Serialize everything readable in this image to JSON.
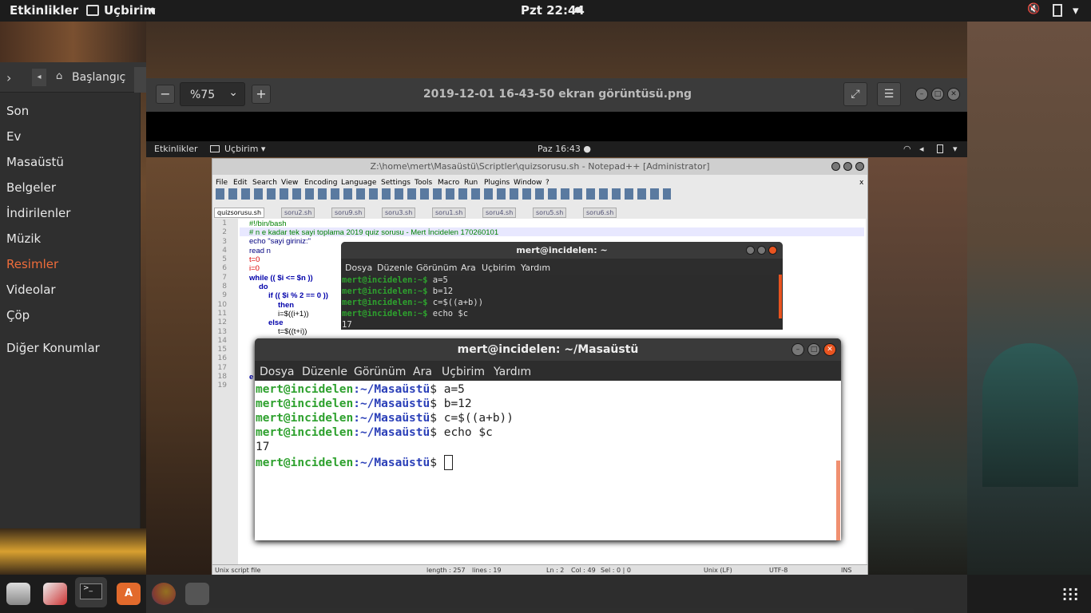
{
  "topbar": {
    "activities": "Etkinlikler",
    "app_menu": "Uçbirim",
    "app_menu_arrow": "▾",
    "clock": "Pzt 22:44",
    "clock_dot": "●",
    "sound_icon": "🔇",
    "battery_icon": "▯",
    "menu_arrow": "▾"
  },
  "files": {
    "path_home": "Başlangıç",
    "path_current": "Resimler",
    "sidebar": [
      "Son",
      "Ev",
      "Masaüstü",
      "Belgeler",
      "İndirilenler",
      "Müzik",
      "Resimler",
      "Videolar",
      "Çöp",
      "Diğer Konumlar"
    ]
  },
  "viewer": {
    "zoom": "%75",
    "title": "2019-12-01 16-43-50 ekran görüntüsü.png",
    "zoom_out": "−",
    "zoom_in": "+",
    "zoom_arrow": "⌄"
  },
  "inner": {
    "activities": "Etkinlikler",
    "app_menu": "Uçbirim ▾",
    "clock": "Paz 16:43 ●"
  },
  "npp": {
    "title": "Z:\\home\\mert\\Masaüstü\\Scriptler\\quizsorusu.sh - Notepad++ [Administrator]",
    "menu": [
      "File",
      "Edit",
      "Search",
      "View",
      "Encoding",
      "Language",
      "Settings",
      "Tools",
      "Macro",
      "Run",
      "Plugins",
      "Window",
      "?"
    ],
    "close_x": "x",
    "tabs": [
      "quizsorusu.sh",
      "soru2.sh",
      "soru9.sh",
      "soru3.sh",
      "soru1.sh",
      "soru4.sh",
      "soru5.sh",
      "soru6.sh"
    ],
    "lines": [
      "#!/bin/bash",
      "# n e kadar tek sayi toplama 2019 quiz sorusu - Mert İncidelen 170260101",
      "echo \"sayi giriniz:\"",
      "read n",
      "t=0",
      "i=0",
      "while (( $i <= $n ))",
      "do",
      "if (( $i % 2 == 0 ))",
      "then",
      "i=$((i+1))",
      "else",
      "t=$((t+i))",
      "",
      "",
      "",
      "",
      "e",
      ""
    ],
    "line_numbers": [
      "1",
      "2",
      "3",
      "4",
      "5",
      "6",
      "7",
      "8",
      "9",
      "10",
      "11",
      "12",
      "13",
      "14",
      "15",
      "16",
      "17",
      "18",
      "19"
    ],
    "status": {
      "type": "Unix script file",
      "length": "length : 257",
      "lines": "lines : 19",
      "ln": "Ln : 2",
      "col": "Col : 49",
      "sel": "Sel : 0 | 0",
      "eol": "Unix (LF)",
      "enc": "UTF-8",
      "ins": "INS"
    }
  },
  "term_small": {
    "title": "mert@incidelen: ~",
    "menu": [
      "Dosya",
      "Düzenle",
      "Görünüm",
      "Ara",
      "Uçbirim",
      "Yardım"
    ],
    "prompt": "mert@incidelen:~$",
    "commands": [
      "a=5",
      "b=12",
      "c=$((a+b))",
      "echo $c"
    ],
    "output": "17"
  },
  "term_big": {
    "title": "mert@incidelen: ~/Masaüstü",
    "menu": [
      "Dosya",
      "Düzenle",
      "Görünüm",
      "Ara",
      "Uçbirim",
      "Yardım"
    ],
    "prompt_user": "mert@incidelen",
    "prompt_path": ":~/Masaüstü",
    "prompt_end": "$",
    "commands": [
      "a=5",
      "b=12",
      "c=$((a+b))",
      "echo $c"
    ],
    "output": "17"
  },
  "buttons": {
    "minimize": "–",
    "maximize": "□",
    "close": "✕"
  },
  "dock": {
    "apps_icon": "⋮⋮⋮"
  },
  "colors": {
    "accent": "#e95420",
    "prompt_green": "#2ea12e",
    "prompt_blue": "#2a3fb8"
  }
}
